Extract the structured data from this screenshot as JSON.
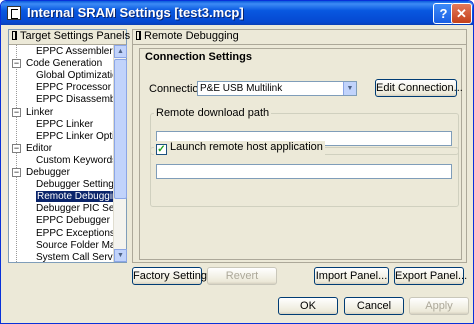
{
  "window": {
    "title": "Internal SRAM Settings [test3.mcp]"
  },
  "titlebar": {
    "help_label": "?",
    "close_label": "✕"
  },
  "tree": {
    "header": "Target Settings Panels",
    "items": [
      {
        "label": "EPPC Assembler",
        "level": "child"
      },
      {
        "label": "Code Generation",
        "level": "category",
        "expander": "−"
      },
      {
        "label": "Global Optimizations",
        "level": "child"
      },
      {
        "label": "EPPC Processor",
        "level": "child"
      },
      {
        "label": "EPPC Disassembler",
        "level": "child"
      },
      {
        "label": "Linker",
        "level": "category",
        "expander": "−"
      },
      {
        "label": "EPPC Linker",
        "level": "child"
      },
      {
        "label": "EPPC Linker Optimi...",
        "level": "child"
      },
      {
        "label": "Editor",
        "level": "category",
        "expander": "−"
      },
      {
        "label": "Custom Keywords",
        "level": "child"
      },
      {
        "label": "Debugger",
        "level": "category",
        "expander": "−"
      },
      {
        "label": "Debugger Settings",
        "level": "child"
      },
      {
        "label": "Remote Debugging",
        "level": "child",
        "selected": true
      },
      {
        "label": "Debugger PIC Setti...",
        "level": "child"
      },
      {
        "label": "EPPC Debugger S...",
        "level": "child"
      },
      {
        "label": "EPPC Exceptions",
        "level": "child"
      },
      {
        "label": "Source Folder Map...",
        "level": "child"
      },
      {
        "label": "System Call Servic...",
        "level": "child"
      }
    ]
  },
  "panel": {
    "header": "Remote Debugging",
    "group_title": "Connection Settings",
    "connection_label": "Connection:",
    "connection_value": "P&E USB Multilink",
    "edit_connection_label": "Edit Connection...",
    "remote_download_label": "Remote download path",
    "remote_download_value": "",
    "launch_label": "Launch remote host application",
    "launch_checked": true,
    "launch_value": ""
  },
  "buttons": {
    "factory_settings": "Factory Settings",
    "revert": "Revert",
    "import_panel": "Import Panel...",
    "export_panel": "Export Panel...",
    "ok": "OK",
    "cancel": "Cancel",
    "apply": "Apply"
  },
  "colors": {
    "titlebar": "#0a5bdc",
    "selection": "#0a246a",
    "dialog_bg": "#ece9d8"
  }
}
